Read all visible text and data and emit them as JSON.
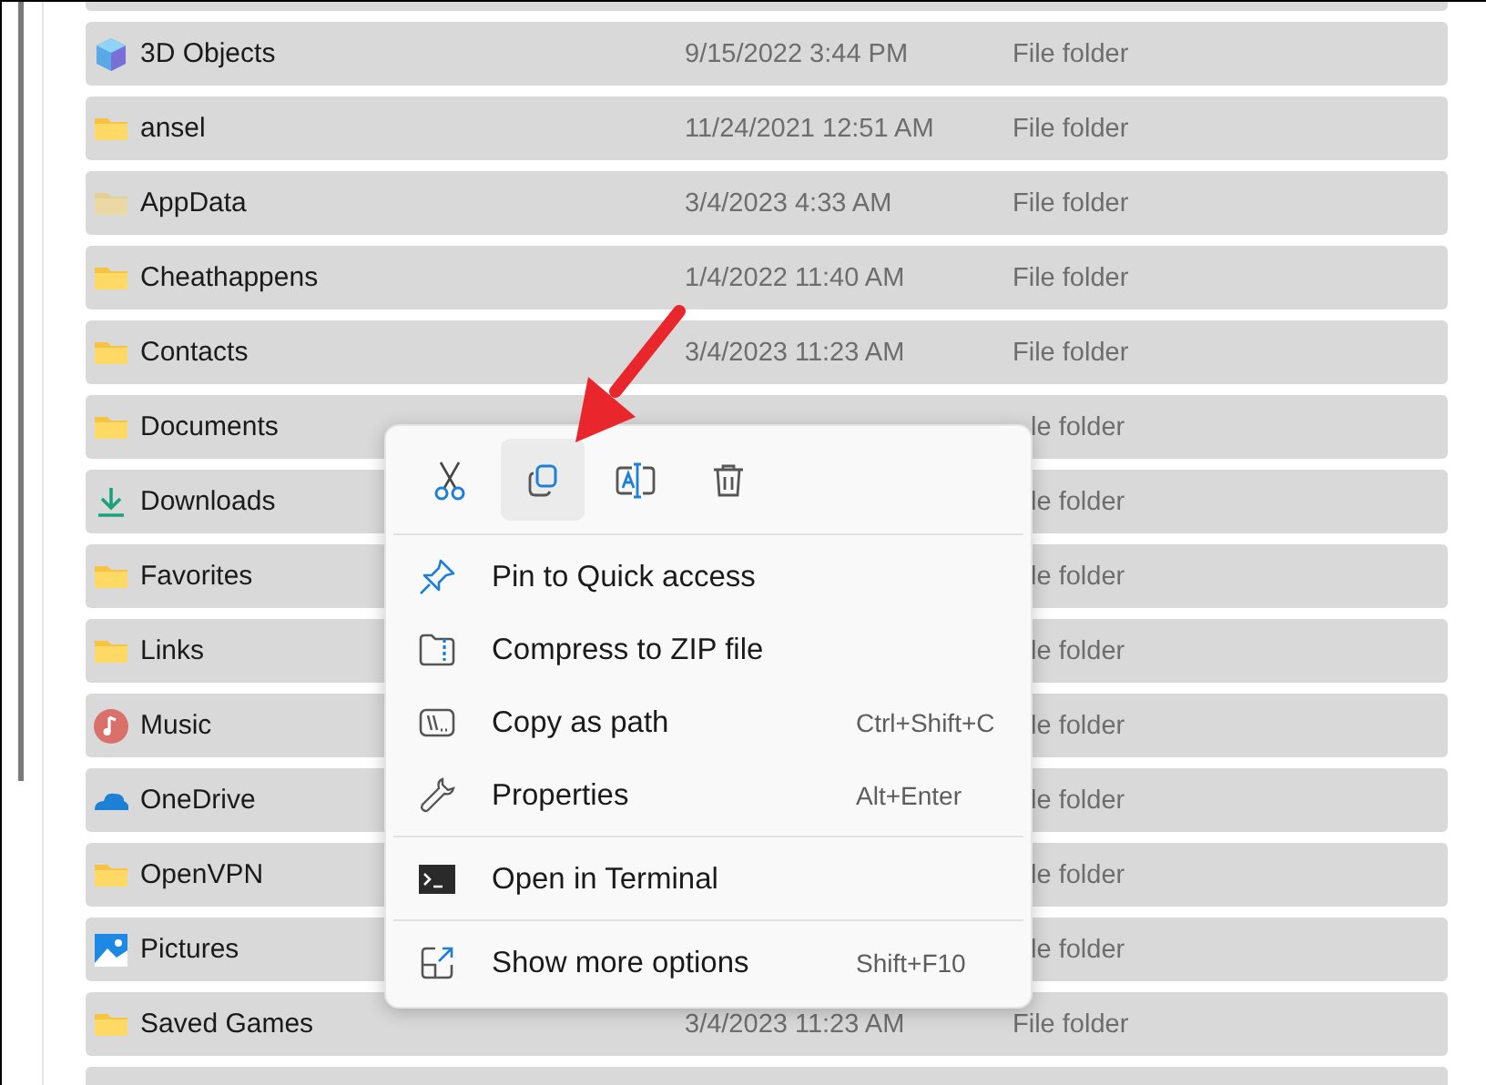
{
  "files": [
    {
      "name": "3D Objects",
      "date": "9/15/2022 3:44 PM",
      "type": "File folder",
      "kind": "cube",
      "hidden": false
    },
    {
      "name": "ansel",
      "date": "11/24/2021 12:51 AM",
      "type": "File folder",
      "kind": "folder",
      "hidden": false
    },
    {
      "name": "AppData",
      "date": "3/4/2023 4:33 AM",
      "type": "File folder",
      "kind": "folder",
      "hidden": true
    },
    {
      "name": "Cheathappens",
      "date": "1/4/2022 11:40 AM",
      "type": "File folder",
      "kind": "folder",
      "hidden": false
    },
    {
      "name": "Contacts",
      "date": "3/4/2023 11:23 AM",
      "type": "File folder",
      "kind": "folder",
      "hidden": false
    },
    {
      "name": "Documents",
      "type": "le folder",
      "kind": "folder",
      "hidden": false
    },
    {
      "name": "Downloads",
      "type": "le folder",
      "kind": "download",
      "hidden": false
    },
    {
      "name": "Favorites",
      "type": "le folder",
      "kind": "folder",
      "hidden": false
    },
    {
      "name": "Links",
      "type": "le folder",
      "kind": "folder",
      "hidden": false
    },
    {
      "name": "Music",
      "type": "le folder",
      "kind": "music",
      "hidden": false
    },
    {
      "name": "OneDrive",
      "type": "le folder",
      "kind": "cloud",
      "hidden": false
    },
    {
      "name": "OpenVPN",
      "type": "le folder",
      "kind": "folder",
      "hidden": false
    },
    {
      "name": "Pictures",
      "type": "le folder",
      "kind": "pictures",
      "hidden": false
    },
    {
      "name": "Saved Games",
      "date": "3/4/2023 11:23 AM",
      "type": "File folder",
      "kind": "folder",
      "hidden": false
    }
  ],
  "context_menu": {
    "toolbar": [
      {
        "kind": "cut",
        "selected": false
      },
      {
        "kind": "copy",
        "selected": true
      },
      {
        "kind": "rename",
        "selected": false
      },
      {
        "kind": "delete",
        "selected": false
      }
    ],
    "groups": [
      [
        {
          "kind": "pin",
          "label": "Pin to Quick access"
        },
        {
          "kind": "zip",
          "label": "Compress to ZIP file"
        },
        {
          "kind": "path",
          "label": "Copy as path",
          "shortcut": "Ctrl+Shift+C"
        },
        {
          "kind": "properties",
          "label": "Properties",
          "shortcut": "Alt+Enter"
        }
      ],
      [
        {
          "kind": "terminal",
          "label": "Open in Terminal"
        }
      ],
      [
        {
          "kind": "more",
          "label": "Show more options",
          "shortcut": "Shift+F10"
        }
      ]
    ]
  }
}
